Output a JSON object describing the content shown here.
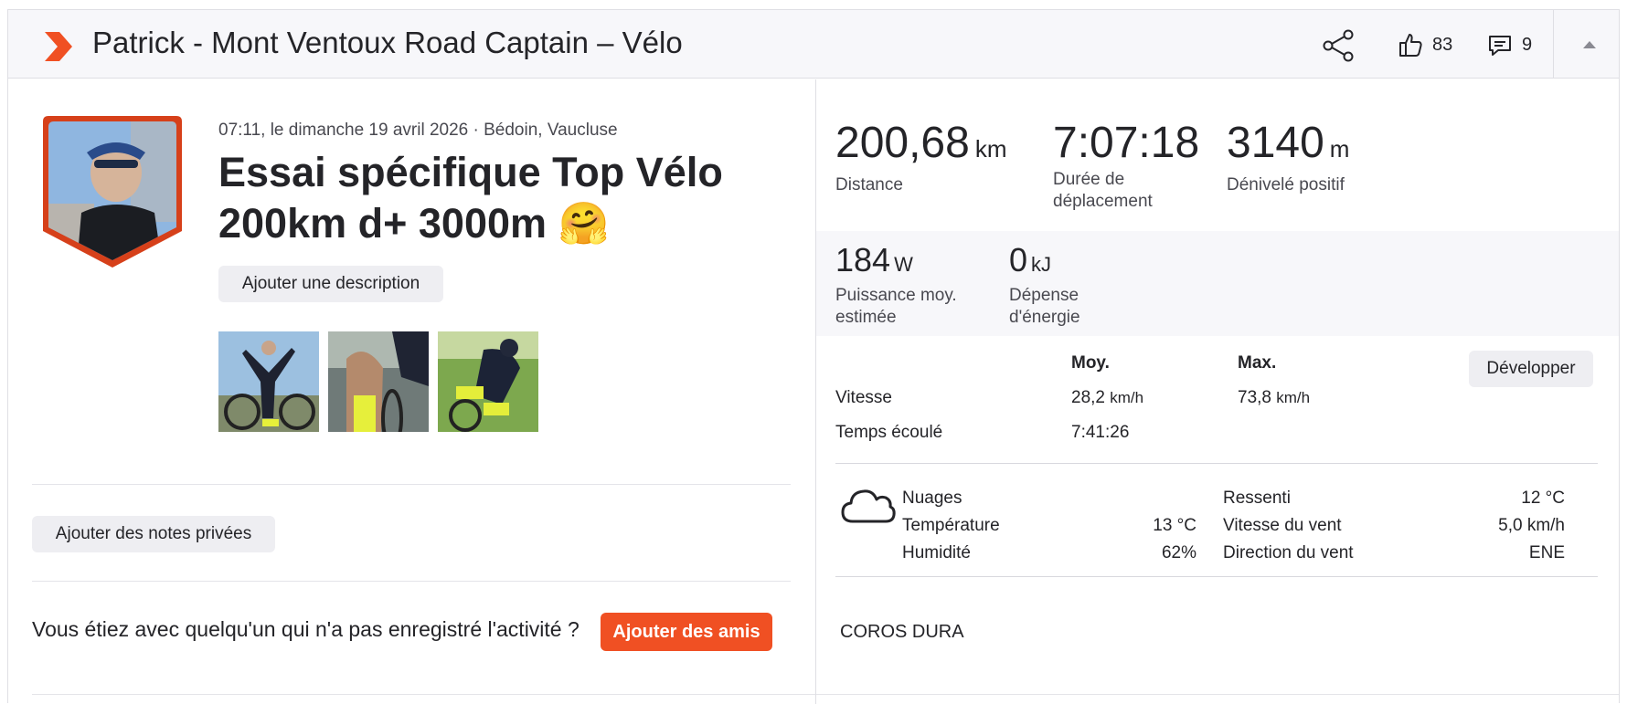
{
  "header": {
    "title": "Patrick - Mont Ventoux Road Captain – Vélo",
    "kudos_count": "83",
    "comments_count": "9",
    "brand_color": "#f05023",
    "icons": [
      "logo-chevron-icon",
      "share-icon",
      "thumbs-up-icon",
      "comment-icon",
      "caret-up-icon"
    ]
  },
  "activity": {
    "meta": "07:11, le dimanche 19 avril 2026 · Bédoin, Vaucluse",
    "title": "Essai spécifique Top Vélo 200km d+ 3000m 🤗",
    "add_description": "Ajouter une description",
    "photos_count": 3,
    "add_private_notes": "Ajouter des notes privées",
    "friends_question": "Vous étiez avec quelqu'un qui n'a pas enregistré l'activité ?",
    "add_friends": "Ajouter des amis"
  },
  "stats": {
    "distance": {
      "value": "200,68",
      "unit": "km",
      "label": "Distance"
    },
    "moving_time": {
      "value": "7:07:18",
      "unit": "",
      "label_1": "Durée de",
      "label_2": "déplacement"
    },
    "elevation": {
      "value": "3140",
      "unit": "m",
      "label": "Dénivelé positif"
    },
    "power": {
      "value": "184",
      "unit": "W",
      "label_1": "Puissance moy.",
      "label_2": "estimée"
    },
    "energy": {
      "value": "0",
      "unit": "kJ",
      "label_1": "Dépense",
      "label_2": "d'énergie"
    }
  },
  "detail_table": {
    "col_avg": "Moy.",
    "col_max": "Max.",
    "expand_button": "Développer",
    "rows": [
      {
        "label": "Vitesse",
        "avg": "28,2",
        "avg_unit": "km/h",
        "max": "73,8",
        "max_unit": "km/h"
      },
      {
        "label": "Temps écoulé",
        "avg": "7:41:26",
        "avg_unit": "",
        "max": "",
        "max_unit": ""
      }
    ]
  },
  "weather": {
    "icon": "cloud-icon",
    "condition": "Nuages",
    "temperature_label": "Température",
    "temperature_value": "13 °C",
    "humidity_label": "Humidité",
    "humidity_value": "62%",
    "feels_like_label": "Ressenti",
    "feels_like_value": "12 °C",
    "wind_speed_label": "Vitesse du vent",
    "wind_speed_value": "5,0 km/h",
    "wind_dir_label": "Direction du vent",
    "wind_dir_value": "ENE"
  },
  "device": "COROS DURA"
}
